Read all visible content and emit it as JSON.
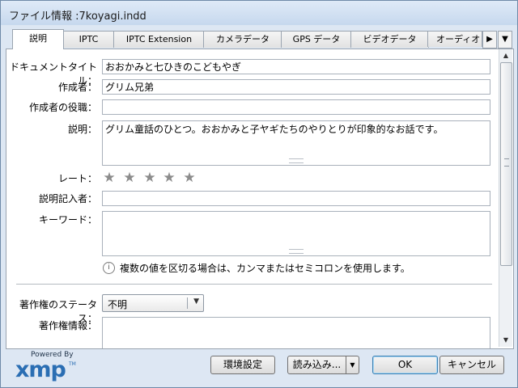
{
  "window": {
    "title": "ファイル情報 :7koyagi.indd"
  },
  "tabs": [
    {
      "label": "説明",
      "active": true
    },
    {
      "label": "IPTC"
    },
    {
      "label": "IPTC Extension"
    },
    {
      "label": "カメラデータ"
    },
    {
      "label": "GPS データ"
    },
    {
      "label": "ビデオデータ"
    },
    {
      "label": "オーディオ"
    }
  ],
  "tab_controls": {
    "next": "▶",
    "menu": "▼"
  },
  "form": {
    "document_title": {
      "label": "ドキュメントタイトル：",
      "value": "おおかみと七ひきのこどもやぎ"
    },
    "author": {
      "label": "作成者：",
      "value": "グリム兄弟"
    },
    "author_title": {
      "label": "作成者の役職：",
      "value": ""
    },
    "description": {
      "label": "説明：",
      "value": "グリム童話のひとつ。おおかみと子ヤギたちのやりとりが印象的なお話です。"
    },
    "rating": {
      "label": "レート：",
      "value": 0,
      "max": 5,
      "star_glyph": "★"
    },
    "description_writer": {
      "label": "説明記入者：",
      "value": ""
    },
    "keywords": {
      "label": "キーワード：",
      "value": ""
    },
    "keywords_hint": "複数の値を区切る場合は、カンマまたはセミコロンを使用します。",
    "info_glyph": "i",
    "copyright_status": {
      "label": "著作権のステータス：",
      "value": "不明"
    },
    "copyright_notice": {
      "label": "著作権情報：",
      "value": ""
    }
  },
  "footer": {
    "powered_by": "Powered By",
    "logo_text": "xmp",
    "logo_tm": "TM",
    "preferences_button": "環境設定",
    "import_button": "読み込み...",
    "ok_button": "OK",
    "cancel_button": "キャンセル"
  },
  "colors": {
    "window_frame": "#dde7f3",
    "xmp_logo": "#2a6eb3",
    "primary_button_border": "#3c7fb1",
    "star_gray": "#8c8c8c"
  }
}
